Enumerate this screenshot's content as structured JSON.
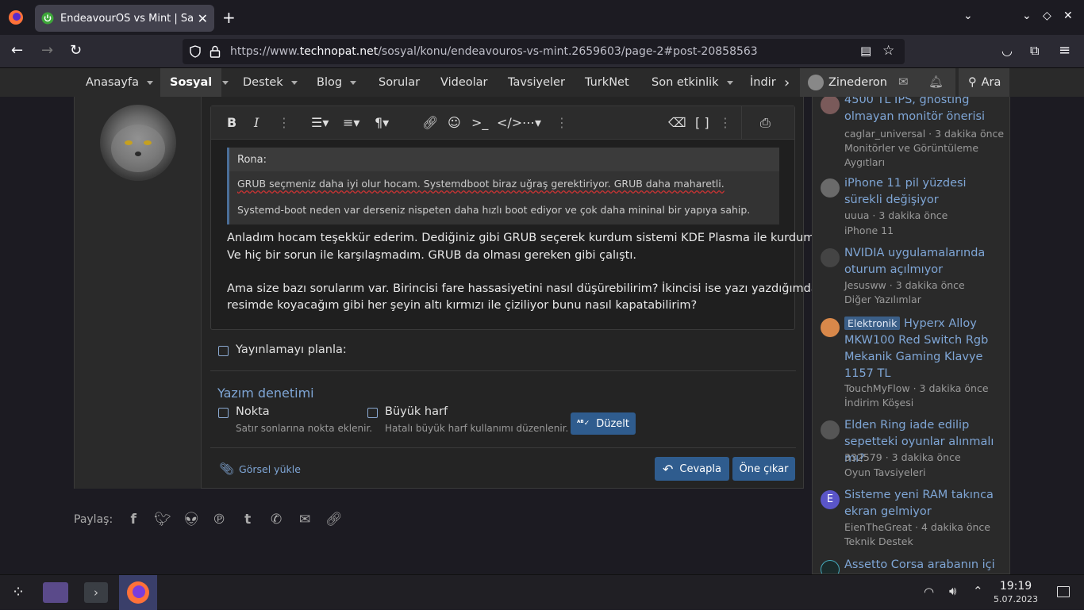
{
  "browser": {
    "tab_title": "EndeavourOS vs Mint | Sa",
    "url_prefix": "https://www.",
    "url_domain": "technopat.net",
    "url_path": "/sosyal/konu/endeavouros-vs-mint.2659603/page-2#post-20858563"
  },
  "sitenav": {
    "items": [
      "Anasayfa",
      "Sosyal",
      "Destek",
      "Blog",
      "Sorular",
      "Videolar",
      "Tavsiyeler",
      "TurkNet",
      "Son etkinlik",
      "İndir"
    ],
    "user": "Zinederon",
    "search": "Ara"
  },
  "editor": {
    "quote_author": "Rona:",
    "quote_lines": [
      "GRUB seçmeniz daha iyi olur hocam. Systemdboot biraz uğraş gerektiriyor. GRUB daha maharetli.",
      "Systemd-boot neden var derseniz nispeten daha hızlı boot ediyor ve çok daha mininal bir yapıya sahip."
    ],
    "body_lines": [
      "Anladım hocam teşekkür ederim. Dediğiniz gibi GRUB seçerek kurdum sistemi KDE Plasma ile kurdum.",
      "Ve hiç bir sorun ile karşılaşmadım. GRUB da olması gereken gibi çalıştı.",
      "Ama size bazı sorularım var. Birincisi fare hassasiyetini nasıl düşürebilirim? İkincisi ise yazı yazdığımda",
      "resimde koyacağım gibi her şeyin altı kırmızı ile çiziliyor bunu nasıl kapatabilirim?"
    ]
  },
  "form": {
    "schedule_label": "Yayınlamayı planla:",
    "spellcheck_title": "Yazım denetimi",
    "nokta_label": "Nokta",
    "nokta_desc": "Satır sonlarına nokta eklenir.",
    "buyuk_label": "Büyük harf",
    "buyuk_desc": "Hatalı büyük harf kullanımı düzenlenir.",
    "duzelt": "Düzelt",
    "upload": "Görsel yükle",
    "reply": "Cevapla",
    "preview": "Öne çıkar"
  },
  "share": {
    "label": "Paylaş:"
  },
  "sidebar": {
    "items": [
      {
        "title": "4500 TL IPS, ghosting olmayan monitör önerisi",
        "meta": "caglar_universal · 3 dakika önce",
        "category": "Monitörler ve Görüntüleme Aygıtları"
      },
      {
        "title": "iPhone 11 pil yüzdesi sürekli değişiyor",
        "meta": "uuua · 3 dakika önce",
        "category": "iPhone 11"
      },
      {
        "title": "NVIDIA uygulamalarında oturum açılmıyor",
        "meta": "Jesusww · 3 dakika önce",
        "category": "Diğer Yazılımlar"
      },
      {
        "tag": "Elektronik",
        "title": "Hyperx Alloy MKW100 Red Switch Rgb Mekanik Gaming Klavye 1157 TL",
        "meta": "TouchMyFlow · 3 dakika önce",
        "category": "İndirim Köşesi"
      },
      {
        "title": "Elden Ring iade edilip sepetteki oyunlar alınmalı mı?",
        "meta": "332579 · 3 dakika önce",
        "category": "Oyun Tavsiyeleri"
      },
      {
        "title": "Sisteme yeni RAM takınca ekran gelmiyor",
        "meta": "EienTheGreat · 4 dakika önce",
        "category": "Teknik Destek",
        "avatar_letter": "E"
      },
      {
        "title": "Assetto Corsa arabanın içi"
      }
    ]
  },
  "taskbar": {
    "time": "19:19",
    "date": "5.07.2023"
  },
  "colors": {
    "accent": "#2f5c8e",
    "link": "#7fa6d6"
  }
}
